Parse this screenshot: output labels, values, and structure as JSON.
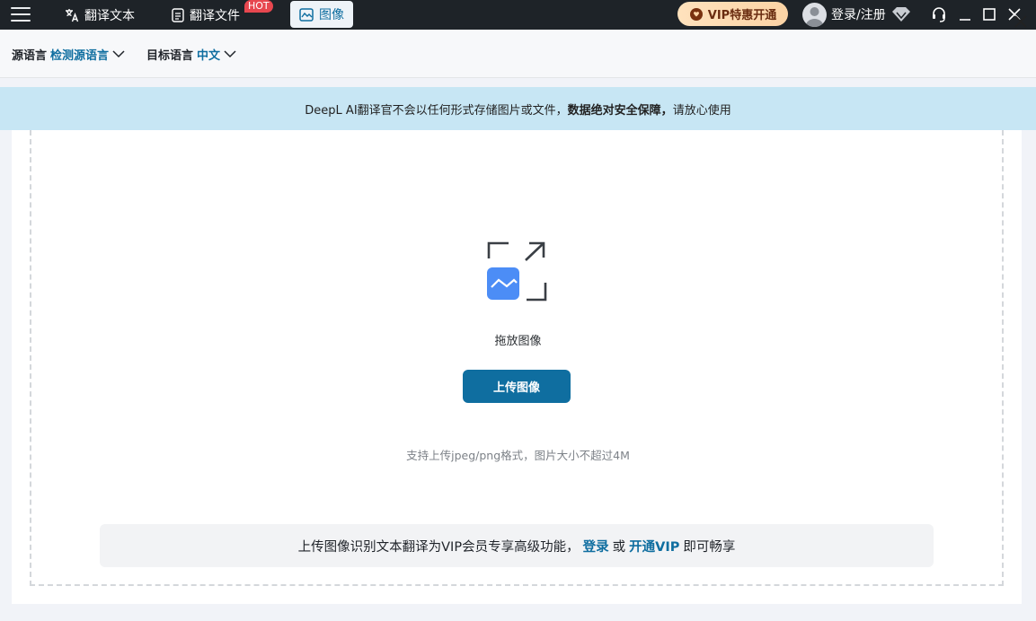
{
  "topbar": {
    "tabs": [
      {
        "label": "翻译文本",
        "icon": "translate-icon"
      },
      {
        "label": "翻译文件",
        "icon": "document-icon",
        "badge": "HOT"
      },
      {
        "label": "图像",
        "icon": "image-icon",
        "active": true
      }
    ],
    "vip_label": "VIP特惠开通",
    "user_label": "登录/注册"
  },
  "langbar": {
    "source_label": "源语言",
    "source_value": "检测源语言",
    "target_label": "目标语言",
    "target_value": "中文"
  },
  "notice": {
    "text_before": "DeepL AI翻译官不会以任何形式存储图片或文件，",
    "text_bold": "数据绝对安全保障，",
    "text_after": "请放心使用"
  },
  "upload": {
    "drop_text": "拖放图像",
    "button_label": "上传图像",
    "hint": "支持上传jpeg/png格式，图片大小不超过4M"
  },
  "vip_note": {
    "text": "上传图像识别文本翻译为VIP会员专享高级功能，",
    "login_link": "登录",
    "or": "或",
    "vip_link": "开通VIP",
    "suffix": "即可畅享"
  },
  "colors": {
    "accent": "#0f6ea0",
    "topbar_bg": "#1e2328",
    "notice_bg": "#c7e6f4",
    "hot_badge": "#e7474f"
  }
}
